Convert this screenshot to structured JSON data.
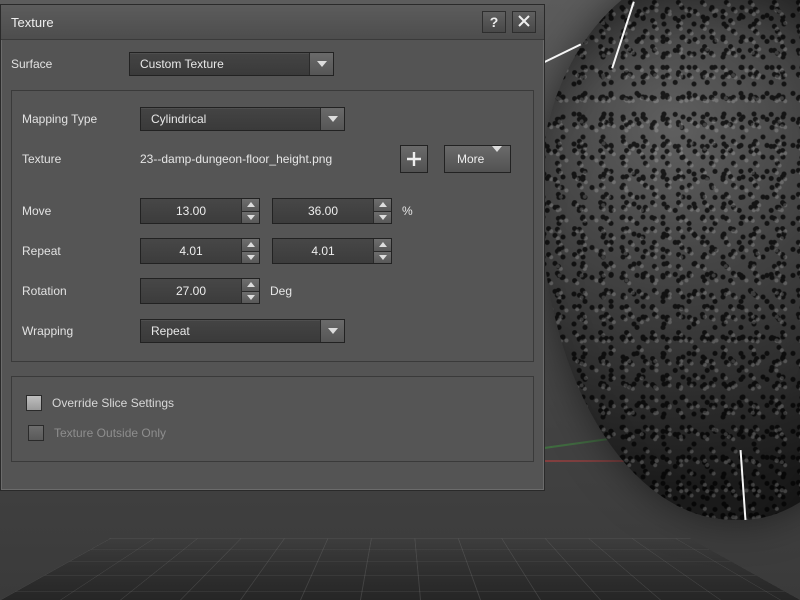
{
  "panel": {
    "title": "Texture",
    "help_tooltip": "?",
    "close_tooltip": "×"
  },
  "surface": {
    "label": "Surface",
    "value": "Custom Texture"
  },
  "mapping": {
    "type_label": "Mapping Type",
    "type_value": "Cylindrical",
    "texture_label": "Texture",
    "texture_file": "23--damp-dungeon-floor_height.png",
    "more_label": "More",
    "move_label": "Move",
    "move_x": "13.00",
    "move_y": "36.00",
    "move_unit": "%",
    "repeat_label": "Repeat",
    "repeat_x": "4.01",
    "repeat_y": "4.01",
    "rotation_label": "Rotation",
    "rotation_value": "27.00",
    "rotation_unit": "Deg",
    "wrapping_label": "Wrapping",
    "wrapping_value": "Repeat"
  },
  "overrides": {
    "slice_label": "Override Slice Settings",
    "outside_label": "Texture Outside Only"
  }
}
